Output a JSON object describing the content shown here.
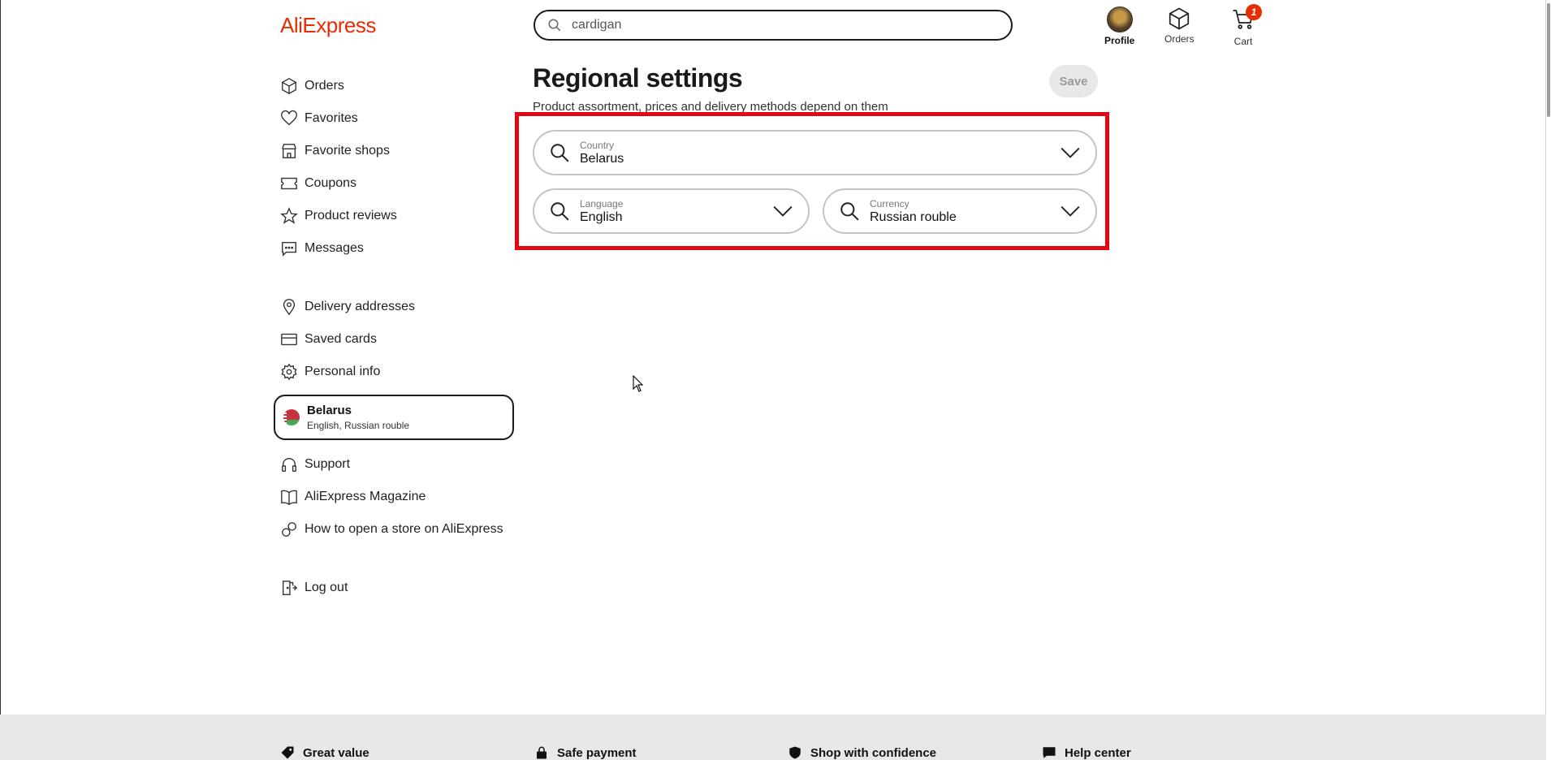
{
  "header": {
    "logo": "AliExpress",
    "search_value": "cardigan",
    "profile_label": "Profile",
    "orders_label": "Orders",
    "cart_label": "Cart",
    "cart_count": "1"
  },
  "sidebar": {
    "group1": [
      {
        "label": "Orders",
        "icon": "box-icon"
      },
      {
        "label": "Favorites",
        "icon": "heart-icon"
      },
      {
        "label": "Favorite shops",
        "icon": "store-icon"
      },
      {
        "label": "Coupons",
        "icon": "coupon-icon"
      },
      {
        "label": "Product reviews",
        "icon": "star-icon"
      },
      {
        "label": "Messages",
        "icon": "message-icon"
      }
    ],
    "group2": [
      {
        "label": "Delivery addresses",
        "icon": "location-pin-icon"
      },
      {
        "label": "Saved cards",
        "icon": "credit-card-icon"
      },
      {
        "label": "Personal info",
        "icon": "gear-icon"
      }
    ],
    "region": {
      "country": "Belarus",
      "details": "English, Russian rouble"
    },
    "group3": [
      {
        "label": "Support",
        "icon": "headphones-icon"
      },
      {
        "label": "AliExpress Magazine",
        "icon": "book-icon"
      },
      {
        "label": "How to open a store on AliExpress",
        "icon": "link-icon"
      }
    ],
    "logout": {
      "label": "Log out",
      "icon": "logout-icon"
    }
  },
  "main": {
    "title": "Regional settings",
    "subtitle": "Product assortment, prices and delivery methods depend on them",
    "save_label": "Save",
    "country": {
      "label": "Country",
      "value": "Belarus"
    },
    "language": {
      "label": "Language",
      "value": "English"
    },
    "currency": {
      "label": "Currency",
      "value": "Russian rouble"
    }
  },
  "footer": {
    "items": [
      "Great value",
      "Safe payment",
      "Shop with confidence",
      "Help center"
    ]
  },
  "colors": {
    "brand": "#e62e04",
    "highlight": "#e30613"
  }
}
